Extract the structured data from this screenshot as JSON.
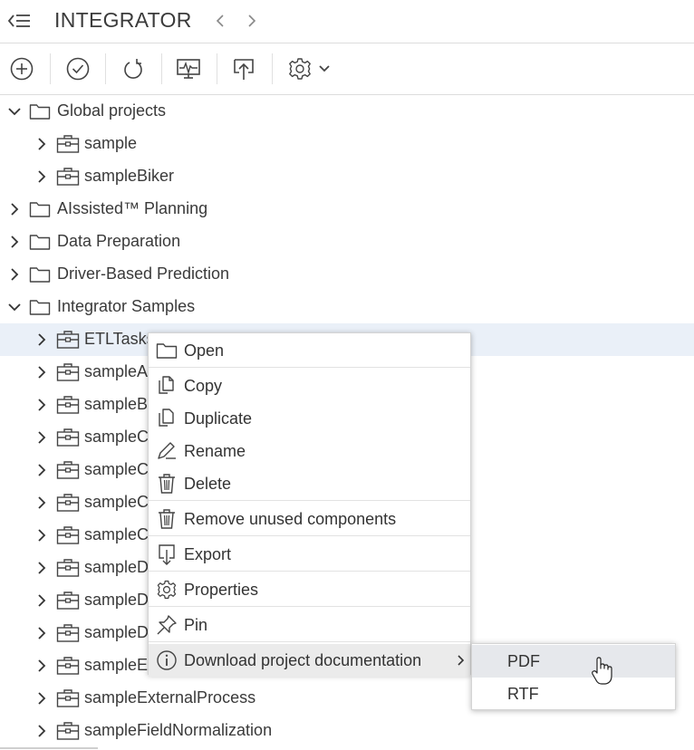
{
  "header": {
    "title": "INTEGRATOR"
  },
  "toolbar": {
    "buttons": [
      {
        "icon": "plus-circle-icon"
      },
      {
        "icon": "check-circle-icon"
      },
      {
        "icon": "refresh-icon"
      },
      {
        "icon": "monitor-icon"
      },
      {
        "icon": "upload-icon"
      },
      {
        "icon": "gear-icon"
      }
    ]
  },
  "tree": {
    "rows": [
      {
        "label": "Global projects",
        "kind": "folder",
        "level": 0,
        "expanded": true
      },
      {
        "label": "sample",
        "kind": "project",
        "level": 1,
        "expanded": false
      },
      {
        "label": "sampleBiker",
        "kind": "project",
        "level": 1,
        "expanded": false
      },
      {
        "label": "AIssisted™ Planning",
        "kind": "folder",
        "level": 0,
        "expanded": false
      },
      {
        "label": "Data Preparation",
        "kind": "folder",
        "level": 0,
        "expanded": false
      },
      {
        "label": "Driver-Based Prediction",
        "kind": "folder",
        "level": 0,
        "expanded": false
      },
      {
        "label": "Integrator Samples",
        "kind": "folder",
        "level": 0,
        "expanded": true
      },
      {
        "label": "ETLTasks",
        "kind": "project",
        "level": 1,
        "expanded": false,
        "selected": true
      },
      {
        "label": "sampleA",
        "kind": "project",
        "level": 1,
        "expanded": false
      },
      {
        "label": "sampleB",
        "kind": "project",
        "level": 1,
        "expanded": false
      },
      {
        "label": "sampleC",
        "kind": "project",
        "level": 1,
        "expanded": false
      },
      {
        "label": "sampleC",
        "kind": "project",
        "level": 1,
        "expanded": false
      },
      {
        "label": "sampleC",
        "kind": "project",
        "level": 1,
        "expanded": false
      },
      {
        "label": "sampleC",
        "kind": "project",
        "level": 1,
        "expanded": false
      },
      {
        "label": "sampleD",
        "kind": "project",
        "level": 1,
        "expanded": false
      },
      {
        "label": "sampleD",
        "kind": "project",
        "level": 1,
        "expanded": false
      },
      {
        "label": "sampleD",
        "kind": "project",
        "level": 1,
        "expanded": false
      },
      {
        "label": "sampleE",
        "kind": "project",
        "level": 1,
        "expanded": false
      },
      {
        "label": "sampleExternalProcess",
        "kind": "project",
        "level": 1,
        "expanded": false
      },
      {
        "label": "sampleFieldNormalization",
        "kind": "project",
        "level": 1,
        "expanded": false
      }
    ]
  },
  "context_menu": {
    "items": [
      {
        "label": "Open",
        "icon": "folder-icon"
      },
      {
        "label": "Copy",
        "icon": "copy-icon"
      },
      {
        "label": "Duplicate",
        "icon": "duplicate-icon"
      },
      {
        "label": "Rename",
        "icon": "rename-icon"
      },
      {
        "label": "Delete",
        "icon": "trash-icon"
      },
      {
        "label": "Remove unused components",
        "icon": "trash-icon"
      },
      {
        "label": "Export",
        "icon": "export-icon"
      },
      {
        "label": "Properties",
        "icon": "gear-icon"
      },
      {
        "label": "Pin",
        "icon": "pin-icon"
      },
      {
        "label": "Download project documentation",
        "icon": "info-icon",
        "has_submenu": true,
        "highlighted": true
      }
    ]
  },
  "submenu": {
    "items": [
      {
        "label": "PDF",
        "highlighted": true
      },
      {
        "label": "RTF"
      }
    ]
  },
  "colors": {
    "selected_row": "#eaf0f8",
    "menu_highlight": "#ebebeb",
    "submenu_highlight": "#e6e8ec"
  }
}
